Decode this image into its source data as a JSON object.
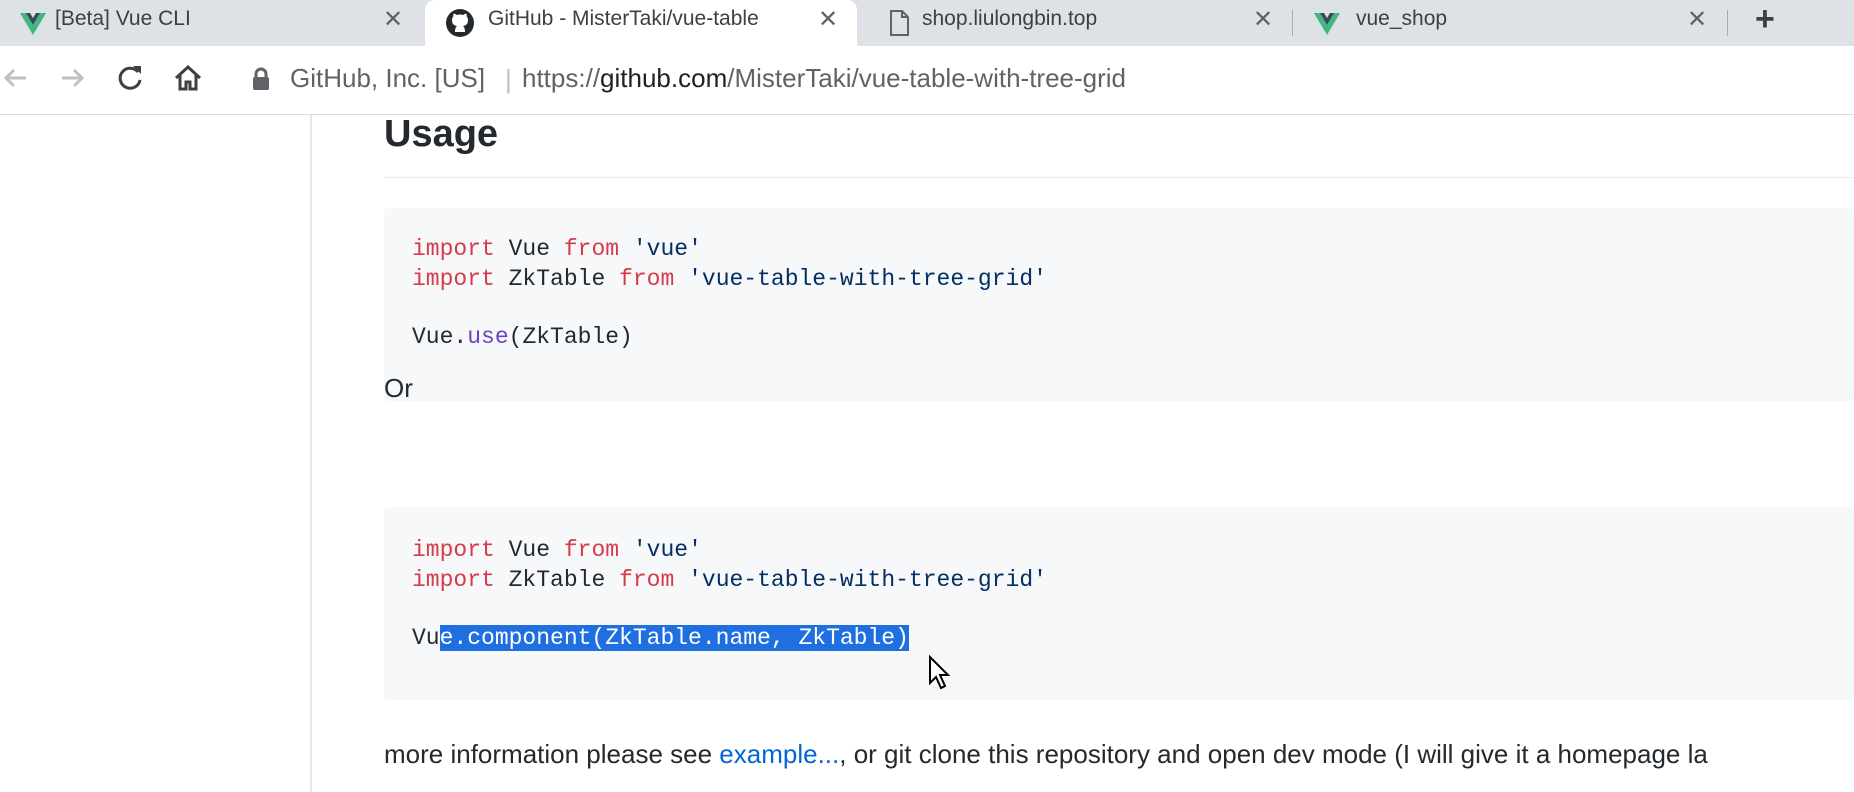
{
  "tabs": [
    {
      "title": "[Beta] Vue CLI",
      "icon": "vue-icon"
    },
    {
      "title": "GitHub - MisterTaki/vue-table",
      "icon": "github-icon",
      "active": true
    },
    {
      "title": "shop.liulongbin.top",
      "icon": "document-icon"
    },
    {
      "title": "vue_shop",
      "icon": "vue-icon"
    }
  ],
  "tab_close": "✕",
  "new_tab": "+",
  "address": {
    "org": "GitHub, Inc. [US]",
    "separator": "|",
    "url_scheme": "https://",
    "url_host": "github.com",
    "url_path": "/MisterTaki/vue-table-with-tree-grid"
  },
  "page": {
    "heading": "Usage",
    "code1": {
      "line1": {
        "kw1": "import",
        "id": " Vue ",
        "kw2": "from",
        "str": " 'vue'"
      },
      "line2": {
        "kw1": "import",
        "id": " ZkTable ",
        "kw2": "from",
        "str": " 'vue-table-with-tree-grid'"
      },
      "line3": {
        "obj": "Vue.",
        "fn": "use",
        "args": "(ZkTable)"
      }
    },
    "or_text": "Or",
    "code2": {
      "line1": {
        "kw1": "import",
        "id": " Vue ",
        "kw2": "from",
        "str": " 'vue'"
      },
      "line2": {
        "kw1": "import",
        "id": " ZkTable ",
        "kw2": "from",
        "str": " 'vue-table-with-tree-grid'"
      },
      "line3": {
        "pre": "Vu",
        "selected": "e.component(ZkTable.name, ZkTable)"
      }
    },
    "more_info": {
      "before": "more information please see ",
      "link": "example...",
      "after": ", or git clone this repository and open dev mode (I will give it a homepage la"
    }
  },
  "colors": {
    "keyword": "#d73a49",
    "string": "#032f62",
    "function": "#6f42c1",
    "link": "#0366d6",
    "selection": "#1f6fe0",
    "vue_green": "#41b883",
    "vue_dark": "#35495e"
  }
}
